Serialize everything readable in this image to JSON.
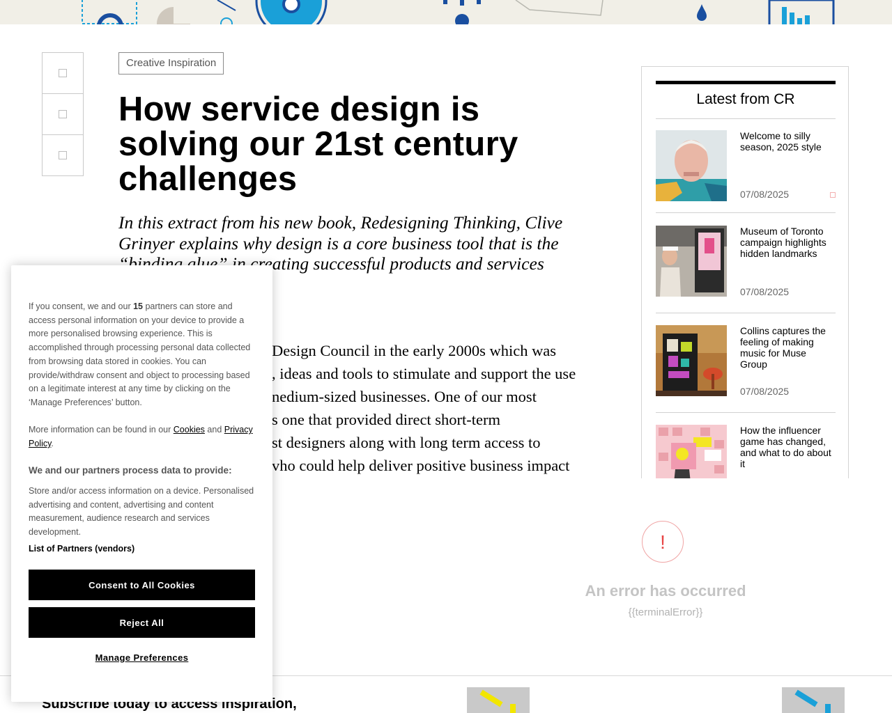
{
  "article": {
    "category": "Creative Inspiration",
    "title": "How service design is solving our 21st century challenges",
    "standfirst": "In this extract from his new book, Redesigning Thinking, Clive Grinyer explains why design is a core business tool that is the “binding glue” in creating successful products and services",
    "body_fragment_lines": [
      "Design Council in the early 2000s which was",
      ", ideas and tools to stimulate and support the use",
      "nedium-sized businesses. One of our most",
      "s one that provided direct short-term",
      "st designers along with long term access to",
      "vho could help deliver positive business impact"
    ]
  },
  "sidebar": {
    "heading": "Latest from CR",
    "items": [
      {
        "title": "Welcome to silly season, 2025 style",
        "date": "07/08/2025"
      },
      {
        "title": "Museum of Toronto campaign highlights hidden landmarks",
        "date": "07/08/2025"
      },
      {
        "title": "Collins captures the feeling of making music for Muse Group",
        "date": "07/08/2025"
      },
      {
        "title": "How the influencer game has changed, and what to do about it",
        "date": ""
      }
    ]
  },
  "error": {
    "icon": "!",
    "title": "An error has occurred",
    "subtitle": "{{terminalError}}"
  },
  "footer": {
    "subscribe": "Subscribe today to access inspiration,"
  },
  "cookie": {
    "intro_before": "If you consent, we and our ",
    "partner_count": "15",
    "intro_after": " partners can store and access personal information on your device to provide a more personalised browsing experience. This is accomplished through processing personal data collected from browsing data stored in cookies. You can provide/withdraw consent and object to processing based on a legitimate interest at any time by clicking on the ‘Manage Preferences’ button.",
    "more_before": "More information can be found in our ",
    "cookies_link": "Cookies",
    "more_and": " and ",
    "privacy_link": "Privacy Policy",
    "more_end": ".",
    "purposes_heading": "We and our partners process data to provide:",
    "purposes_text": "Store and/or access information on a device. Personalised advertising and content, advertising and content measurement, audience research and services development.",
    "vendors_label": "List of Partners (vendors)",
    "consent_button": "Consent to All Cookies",
    "reject_button": "Reject All",
    "manage_link": "Manage Preferences"
  },
  "colors": {
    "banner_bg": "#f1efe7",
    "banner_blue": "#1a4fa0",
    "banner_cyan": "#1aa0d8",
    "error_red": "#e84545",
    "promo_yellow": "#f2e600"
  },
  "icons": [
    "share-box-icon",
    "bookmark-icon",
    "error-exclamation-icon"
  ]
}
